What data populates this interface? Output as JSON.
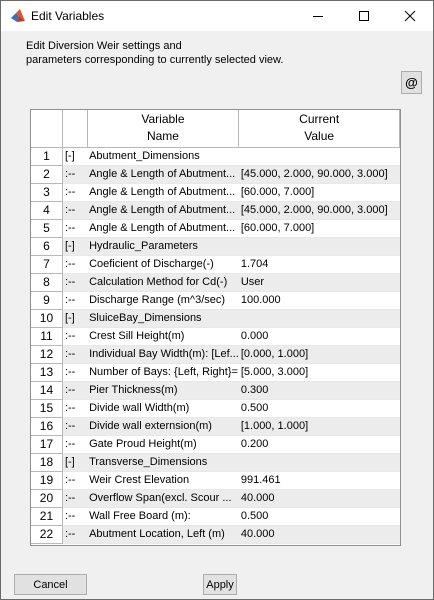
{
  "window": {
    "title": "Edit Variables",
    "app_icon": "matlab-icon"
  },
  "description": "Edit Diversion Weir settings and\nparameters corresponding to currently selected view.",
  "at_button_label": "@",
  "table": {
    "header_variable": "Variable",
    "header_name": "Name",
    "header_current": "Current",
    "header_value": "Value",
    "rows": [
      {
        "num": "1",
        "tree": "[-]",
        "name": "Abutment_Dimensions",
        "value": ""
      },
      {
        "num": "2",
        "tree": ":--",
        "name": "Angle & Length of Abutment...",
        "value": "[45.000, 2.000, 90.000, 3.000]"
      },
      {
        "num": "3",
        "tree": ":--",
        "name": "Angle & Length of Abutment...",
        "value": "[60.000, 7.000]"
      },
      {
        "num": "4",
        "tree": ":--",
        "name": "Angle & Length of Abutment...",
        "value": "[45.000, 2.000, 90.000, 3.000]"
      },
      {
        "num": "5",
        "tree": ":--",
        "name": "Angle & Length of Abutment...",
        "value": "[60.000, 7.000]"
      },
      {
        "num": "6",
        "tree": "[-]",
        "name": "Hydraulic_Parameters",
        "value": ""
      },
      {
        "num": "7",
        "tree": ":--",
        "name": "Coeficient of Discharge(-)",
        "value": "1.704"
      },
      {
        "num": "8",
        "tree": ":--",
        "name": "Calculation Method for Cd(-)",
        "value": "User"
      },
      {
        "num": "9",
        "tree": ":--",
        "name": "Discharge Range (m^3/sec)",
        "value": "100.000"
      },
      {
        "num": "10",
        "tree": "[-]",
        "name": "SluiceBay_Dimensions",
        "value": ""
      },
      {
        "num": "11",
        "tree": ":--",
        "name": "Crest Sill Height(m)",
        "value": "0.000"
      },
      {
        "num": "12",
        "tree": ":--",
        "name": "Individual Bay Width(m): [Lef...",
        "value": "[0.000, 1.000]"
      },
      {
        "num": "13",
        "tree": ":--",
        "name": "Number of Bays: {Left, Right}=",
        "value": "[5.000, 3.000]"
      },
      {
        "num": "14",
        "tree": ":--",
        "name": "Pier Thickness(m)",
        "value": "0.300"
      },
      {
        "num": "15",
        "tree": ":--",
        "name": "Divide wall Width(m)",
        "value": "0.500"
      },
      {
        "num": "16",
        "tree": ":--",
        "name": "Divide wall externsion(m)",
        "value": "[1.000, 1.000]"
      },
      {
        "num": "17",
        "tree": ":--",
        "name": "Gate Proud Height(m)",
        "value": "0.200"
      },
      {
        "num": "18",
        "tree": "[-]",
        "name": "Transverse_Dimensions",
        "value": ""
      },
      {
        "num": "19",
        "tree": ":--",
        "name": "Weir Crest Elevation",
        "value": "991.461"
      },
      {
        "num": "20",
        "tree": ":--",
        "name": "Overflow Span(excl. Scour ...",
        "value": "40.000"
      },
      {
        "num": "21",
        "tree": ":--",
        "name": "Wall Free Board (m):",
        "value": "0.500"
      },
      {
        "num": "22",
        "tree": ":--",
        "name": "Abutment Location, Left (m)",
        "value": "40.000"
      }
    ]
  },
  "buttons": {
    "cancel": "Cancel",
    "apply": "Apply"
  }
}
